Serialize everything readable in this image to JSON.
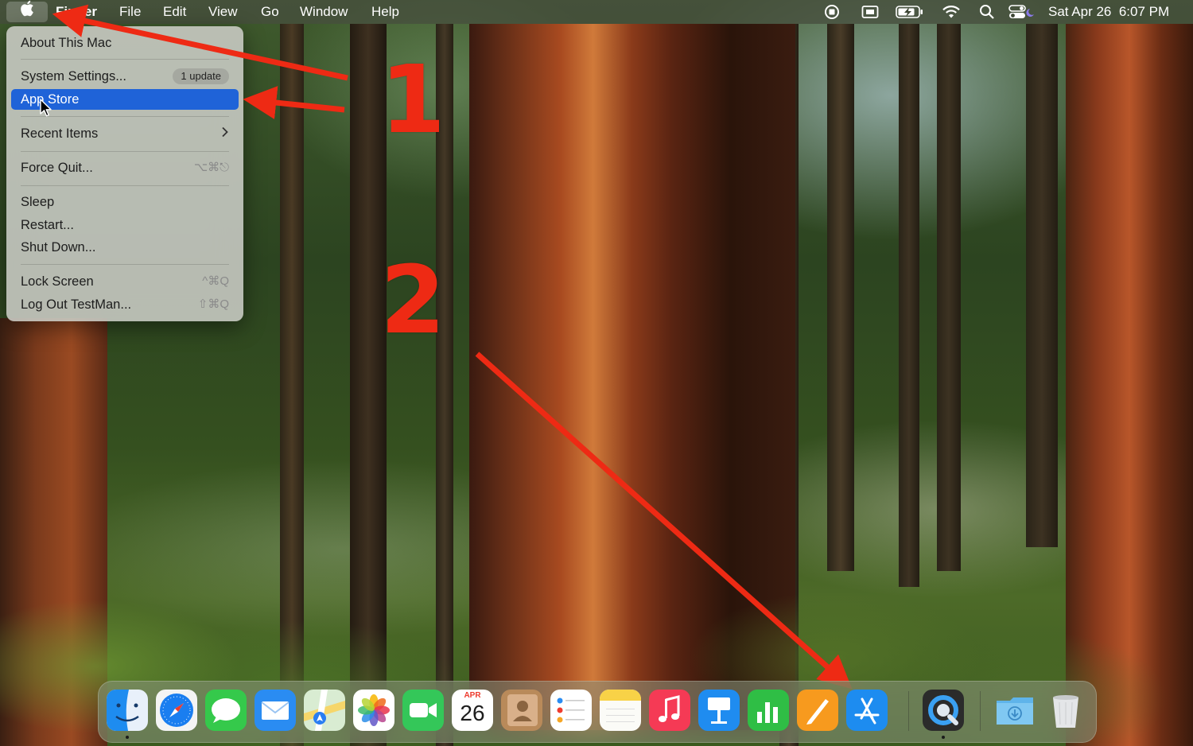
{
  "menubar": {
    "app_menus": [
      "Finder",
      "File",
      "Edit",
      "View",
      "Go",
      "Window",
      "Help"
    ],
    "clock": "Sat Apr 26  6:07 PM",
    "status_icons": [
      "screen-record-icon",
      "screen-share-icon",
      "battery-charging-icon",
      "wifi-icon",
      "spotlight-search-icon",
      "control-center-icon"
    ]
  },
  "apple_menu": {
    "about": "About This Mac",
    "system_settings": "System Settings...",
    "update_badge": "1 update",
    "app_store": "App Store",
    "recent_items": "Recent Items",
    "force_quit": "Force Quit...",
    "force_quit_shortcut": "⌥⌘⎋",
    "sleep": "Sleep",
    "restart": "Restart...",
    "shut_down": "Shut Down...",
    "lock_screen": "Lock Screen",
    "lock_screen_shortcut": "^⌘Q",
    "log_out": "Log Out TestMan...",
    "log_out_shortcut": "⇧⌘Q"
  },
  "annotations": {
    "step1": "1",
    "step2": "2",
    "arrow_color": "#ee2a14"
  },
  "calendar_icon": {
    "month": "APR",
    "day": "26"
  },
  "dock": {
    "apps": [
      "Finder",
      "Safari",
      "Messages",
      "Mail",
      "Maps",
      "Photos",
      "FaceTime",
      "Calendar",
      "Contacts",
      "Reminders",
      "Notes",
      "Music",
      "Keynote",
      "Numbers",
      "Pages",
      "App Store",
      "QuickTime Player",
      "Downloads",
      "Trash"
    ]
  }
}
